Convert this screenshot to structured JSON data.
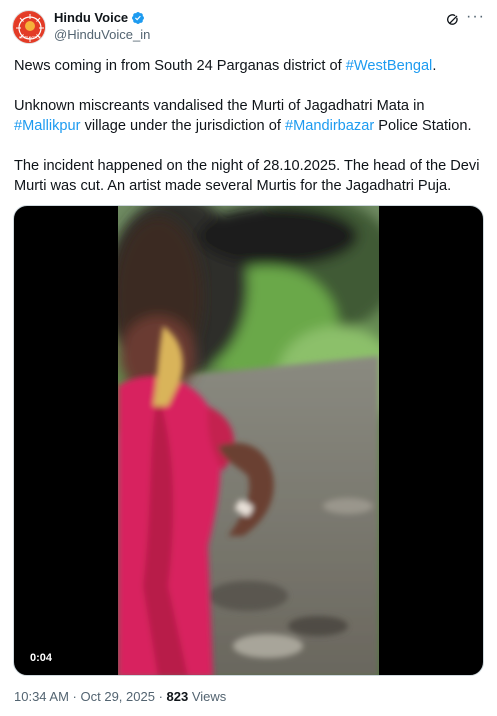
{
  "author": {
    "display_name": "Hindu Voice",
    "handle": "@HinduVoice_in",
    "verified": true,
    "avatar_icon": "hindu-voice-logo",
    "avatar_text": "HINDU VOICE"
  },
  "actions": {
    "grok_icon": "grok-icon",
    "more_label": "···"
  },
  "tweet": {
    "p1_before": "News coming in from South 24 Parganas district of ",
    "p1_tag": "#WestBengal",
    "p1_after": ".",
    "p2_a": "Unknown miscreants vandalised the Murti of Jagadhatri Mata in ",
    "p2_tag1": "#Mallikpur",
    "p2_b": " village under the jurisdiction of ",
    "p2_tag2": "#Mandirbazar",
    "p2_c": " Police Station.",
    "p3": "The incident happened on the night of 28.10.2025. The head of the Devi Murti was cut. An artist made several Murtis for the Jagadhatri Puja."
  },
  "media": {
    "type": "video",
    "duration": "0:04"
  },
  "meta": {
    "time": "10:34 AM",
    "separator": " · ",
    "date": "Oct 29, 2025",
    "views_count": "823",
    "views_label": " Views"
  },
  "colors": {
    "link": "#1d9bf0",
    "text": "#0f1419",
    "muted": "#536471",
    "verified": "#1d9bf0"
  }
}
